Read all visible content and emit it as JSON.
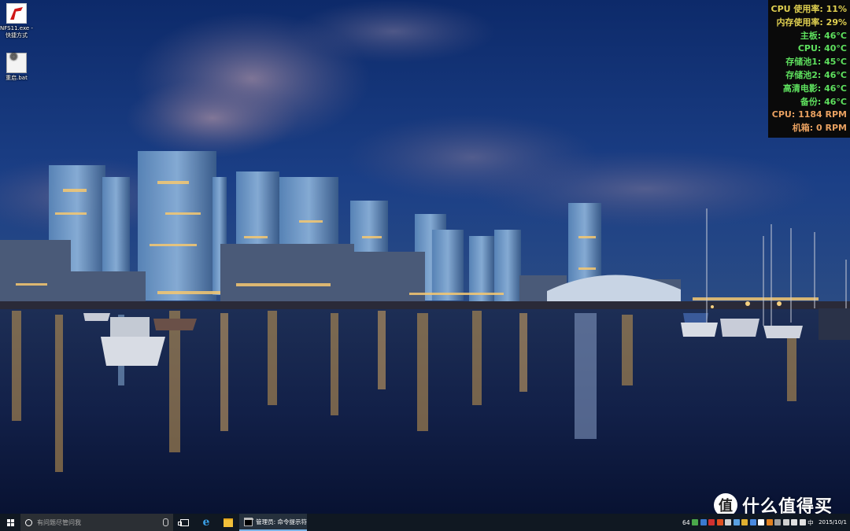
{
  "desktop": {
    "icons": [
      {
        "label_line1": "NFS11.exe -",
        "label_line2": "快捷方式",
        "icon": "nfs-red-logo-icon"
      },
      {
        "label": "重启.bat",
        "icon": "batch-file-icon"
      }
    ]
  },
  "hw_monitor": {
    "rows": [
      {
        "text": "CPU 使用率: 11%",
        "color": "#e0d050"
      },
      {
        "text": "内存使用率: 29%",
        "color": "#e0d050"
      },
      {
        "text": "主板: 46°C",
        "color": "#5ee05e"
      },
      {
        "text": "CPU: 40°C",
        "color": "#5ee05e"
      },
      {
        "text": "存储池1: 45°C",
        "color": "#5ee05e"
      },
      {
        "text": "存储池2: 46°C",
        "color": "#5ee05e"
      },
      {
        "text": "高清电影: 46°C",
        "color": "#5ee05e"
      },
      {
        "text": "备份: 46°C",
        "color": "#5ee05e"
      },
      {
        "text": "CPU: 1184 RPM",
        "color": "#e8a060"
      },
      {
        "text": "机箱: 0 RPM",
        "color": "#e8a060"
      }
    ]
  },
  "watermark": {
    "badge": "值",
    "text": "什么值得买"
  },
  "taskbar": {
    "search_placeholder": "有问题尽管问我",
    "running_app": "管理员: 命令提示符",
    "tray_items": [
      {
        "kind": "text",
        "text": "64"
      },
      {
        "kind": "icon",
        "icon": "chat-icon",
        "color": "#4aa84a"
      },
      {
        "kind": "icon",
        "icon": "shield-icon",
        "color": "#3a7ad0"
      },
      {
        "kind": "icon",
        "icon": "app-icon",
        "color": "#d03030"
      },
      {
        "kind": "icon",
        "icon": "app-icon",
        "color": "#e05020"
      },
      {
        "kind": "icon",
        "icon": "app-icon",
        "color": "#d0d0d0"
      },
      {
        "kind": "icon",
        "icon": "network-icon",
        "color": "#5aa0e0"
      },
      {
        "kind": "icon",
        "icon": "app-icon",
        "color": "#e0b030"
      },
      {
        "kind": "icon",
        "icon": "bluetooth-icon",
        "color": "#4a8ae0"
      },
      {
        "kind": "icon",
        "icon": "app-icon",
        "color": "#ffffff"
      },
      {
        "kind": "icon",
        "icon": "app-icon",
        "color": "#e08020"
      },
      {
        "kind": "icon",
        "icon": "app-icon",
        "color": "#a0a0a0"
      },
      {
        "kind": "icon",
        "icon": "app-icon",
        "color": "#d0d0d0"
      },
      {
        "kind": "icon",
        "icon": "message-icon",
        "color": "#e0e0e0"
      },
      {
        "kind": "icon",
        "icon": "volume-icon",
        "color": "#e0e0e0"
      },
      {
        "kind": "text",
        "text": "中"
      }
    ],
    "clock_date": "2015/10/1"
  }
}
